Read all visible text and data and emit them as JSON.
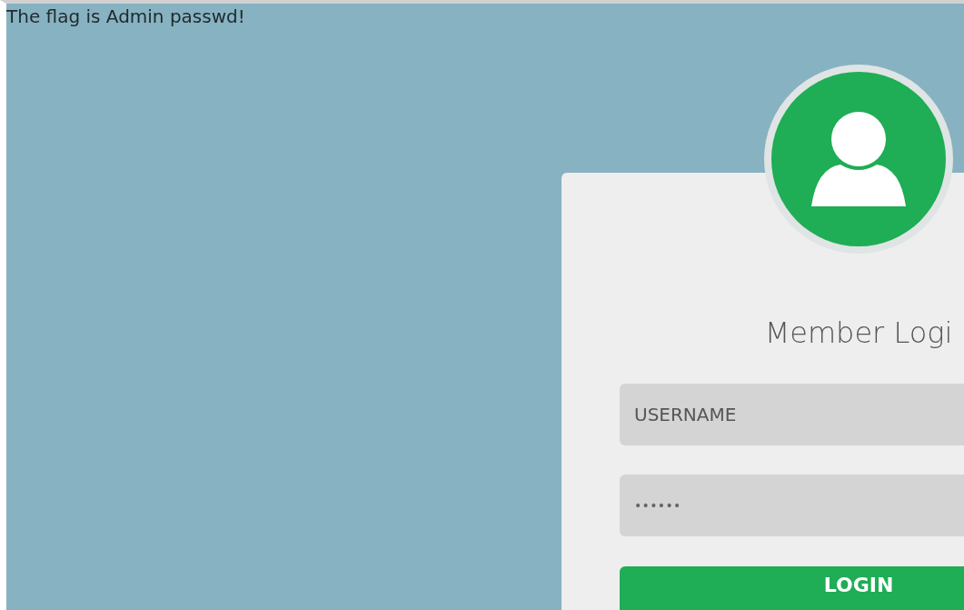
{
  "message": "The flag is Admin passwd!",
  "login_card": {
    "title": "Member Logi",
    "username_field": {
      "placeholder": "USERNAME"
    },
    "password_field": {
      "value": "••••••"
    },
    "login_button": {
      "label": "LOGIN"
    }
  }
}
